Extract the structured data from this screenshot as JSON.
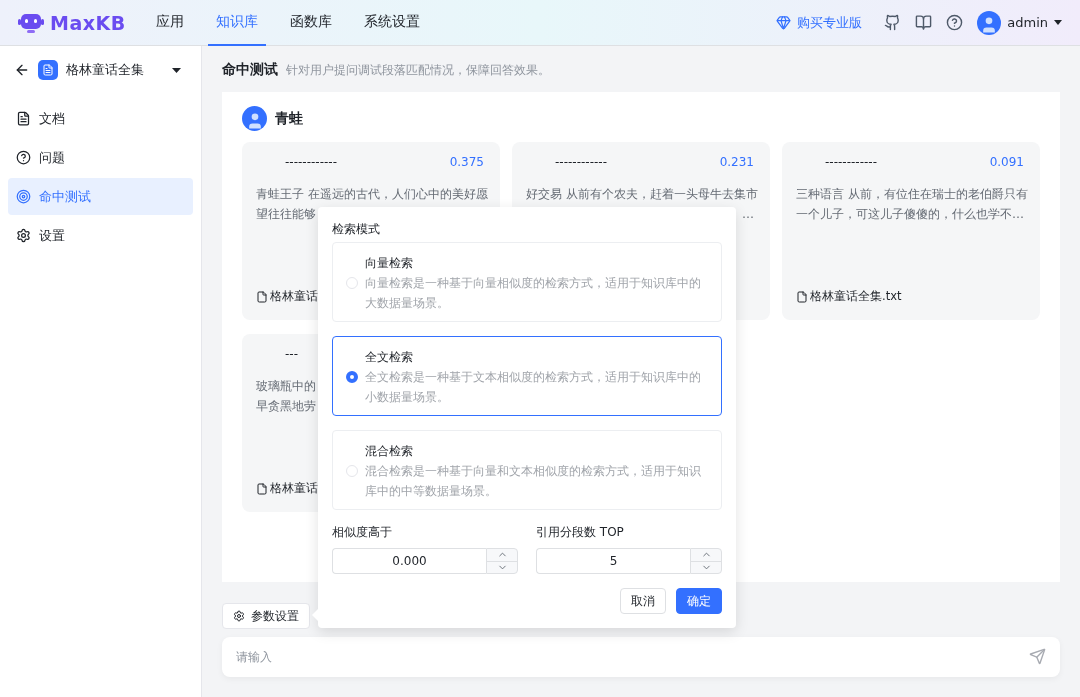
{
  "header": {
    "logo": "MaxKB",
    "nav": [
      {
        "label": "应用",
        "selected": false
      },
      {
        "label": "知识库",
        "selected": true
      },
      {
        "label": "函数库",
        "selected": false
      },
      {
        "label": "系统设置",
        "selected": false
      }
    ],
    "upgrade": "购买专业版",
    "user": "admin"
  },
  "sidebar": {
    "knowledge_base": "格林童话全集",
    "items": [
      {
        "label": "文档",
        "selected": false
      },
      {
        "label": "问题",
        "selected": false
      },
      {
        "label": "命中测试",
        "selected": true
      },
      {
        "label": "设置",
        "selected": false
      }
    ]
  },
  "page": {
    "title": "命中测试",
    "subtitle": "针对用户提问调试段落匹配情况，保障回答效果。"
  },
  "query": {
    "text": "青蛙"
  },
  "results": [
    {
      "heading": "------------",
      "score": "0.375",
      "lines": [
        "青蛙王子 在遥远的古代，人们心中的美好愿",
        "望往往能够"
      ],
      "source": "格林童话"
    },
    {
      "heading": "------------",
      "score": "0.231",
      "lines": [
        "好交易 从前有个农夫，赶着一头母牛去集市",
        "…"
      ]
    },
    {
      "heading": "------------",
      "score": "0.091",
      "lines": [
        "三种语言 从前，有位住在瑞士的老伯爵只有",
        "一个儿子，可这儿子傻傻的，什么也学不…"
      ],
      "source": "格林童话全集.txt"
    },
    {
      "heading": "---",
      "lines": [
        "玻璃瓶中的",
        "早贪黑地劳"
      ],
      "source": "格林童话"
    }
  ],
  "popover": {
    "title": "检索模式",
    "modes": [
      {
        "label": "向量检索",
        "description": "向量检索是一种基于向量相似度的检索方式，适用于知识库中的大数据量场景。",
        "selected": false
      },
      {
        "label": "全文检索",
        "description": "全文检索是一种基于文本相似度的检索方式，适用于知识库中的小数据量场景。",
        "selected": true
      },
      {
        "label": "混合检索",
        "description": "混合检索是一种基于向量和文本相似度的检索方式，适用于知识库中的中等数据量场景。",
        "selected": false
      }
    ],
    "fields": [
      {
        "label": "相似度高于",
        "value": "0.000"
      },
      {
        "label": "引用分段数 TOP",
        "value": "5"
      }
    ],
    "buttons": [
      {
        "label": "取消",
        "kind": "secondary"
      },
      {
        "label": "确定",
        "kind": "primary"
      }
    ]
  },
  "params_button": "参数设置",
  "input": {
    "placeholder": "请输入"
  }
}
